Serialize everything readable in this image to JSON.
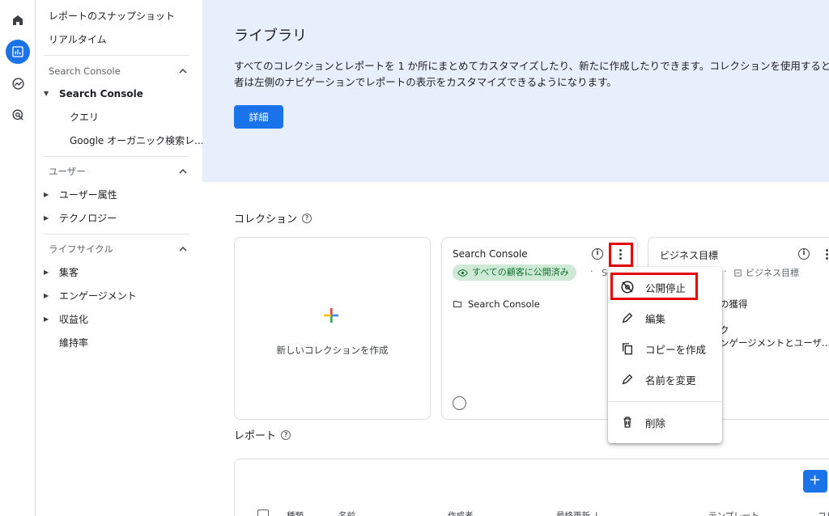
{
  "sidenav": {
    "top_items": [
      "レポートのスナップショット",
      "リアルタイム"
    ],
    "sections": [
      {
        "title": "Search Console",
        "items": [
          {
            "label": "Search Console",
            "level": 0,
            "expanded": true,
            "bold": true
          },
          {
            "label": "クエリ",
            "level": 1
          },
          {
            "label": "Google オーガニック検索レ...",
            "level": 1
          }
        ]
      },
      {
        "title": "ユーザー",
        "items": [
          {
            "label": "ユーザー属性",
            "level": 0,
            "expanded": false
          },
          {
            "label": "テクノロジー",
            "level": 0,
            "expanded": false
          }
        ]
      },
      {
        "title": "ライフサイクル",
        "items": [
          {
            "label": "集客",
            "level": 0,
            "expanded": false
          },
          {
            "label": "エンゲージメント",
            "level": 0,
            "expanded": false
          },
          {
            "label": "収益化",
            "level": 0,
            "expanded": false
          },
          {
            "label": "維持率",
            "level": 0
          }
        ]
      }
    ]
  },
  "hero": {
    "title": "ライブラリ",
    "description_line1": "すべてのコレクションとレポートを 1 か所にまとめてカスタマイズしたり、新たに作成したりできます。コレクションを使用すると",
    "description_line2": "者は左側のナビゲーションでレポートの表示をカスタマイズできるようになります。",
    "details_button": "詳細"
  },
  "collections": {
    "title": "コレクション",
    "new_card_label": "新しいコレクションを作成",
    "cards": [
      {
        "title": "Search Console",
        "chip": "すべての顧客に公開済み",
        "sub": "Se",
        "folder": "Search Console"
      },
      {
        "title": "ビジネス目標",
        "sub": "ビジネス目標",
        "lines": [
          "の獲得",
          "ク",
          "ンゲージメントとユーザ..."
        ]
      }
    ]
  },
  "menu": {
    "items": [
      {
        "label": "公開停止",
        "icon": "eye-off-icon"
      },
      {
        "label": "編集",
        "icon": "pencil-icon"
      },
      {
        "label": "コピーを作成",
        "icon": "copy-icon"
      },
      {
        "label": "名前を変更",
        "icon": "pencil-icon"
      },
      {
        "label": "削除",
        "icon": "trash-icon"
      }
    ]
  },
  "reports": {
    "title": "レポート",
    "fab": "+",
    "columns": [
      "種類",
      "名前",
      "作成者",
      "最終更新 ↓",
      "テンプレート",
      "コレ"
    ]
  },
  "colors": {
    "primary": "#1a73e8",
    "hero_bg": "#e8effc",
    "chip_bg": "#ceead6",
    "chip_text": "#137333",
    "highlight": "#e50000"
  }
}
